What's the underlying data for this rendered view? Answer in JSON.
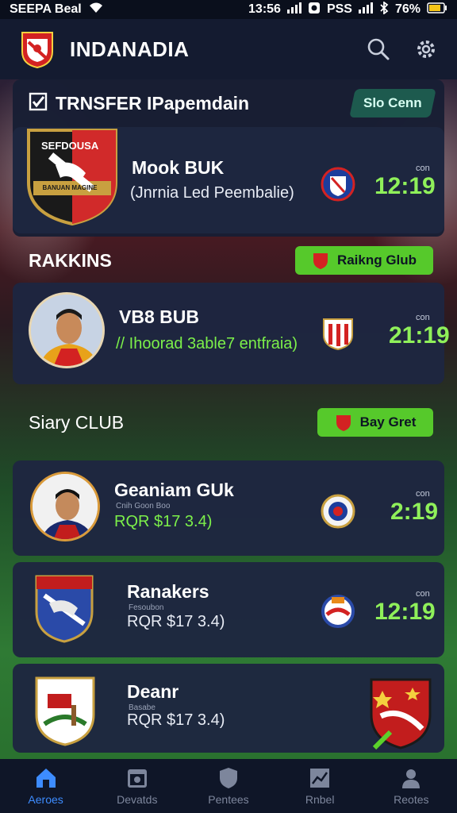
{
  "status_bar": {
    "carrier": "SEEPA Beal",
    "time": "13:56",
    "signal_text": "PSS",
    "battery": "76%"
  },
  "header": {
    "title": "INDANADIA"
  },
  "transfer_section": {
    "title": "TRNSFER IPapemdain",
    "pill_label": "Slo Cenn",
    "row": {
      "crest_text": "SEFDOUSA",
      "crest_banner": "BANUAN MAGINE",
      "name": "Mook BUK",
      "subtitle": "(Jnrnia Led Peembalie)",
      "score_label": "con",
      "score": "12:19"
    }
  },
  "rankings_section": {
    "title": "RAKKINS",
    "pill_label": "Raikng Glub",
    "row": {
      "name": "VB8 BUB",
      "subtitle": "// Ihoorad 3able7 entfraia)",
      "score_label": "con",
      "score": "21:19"
    }
  },
  "club_section": {
    "title": "Siary CLUB",
    "pill_label": "Bay Gret",
    "rows": [
      {
        "name": "Geaniam GUk",
        "tiny": "Cnih Goon Boo",
        "subtitle": "RQR $17 3.4)",
        "score_label": "con",
        "score": "2:19"
      },
      {
        "name": "Ranakers",
        "tiny": "Fesoubon",
        "subtitle": "RQR $17 3.4)",
        "score_label": "con",
        "score": "12:19"
      },
      {
        "name": "Deanr",
        "tiny": "Basabe",
        "subtitle": "RQR $17 3.4)"
      }
    ]
  },
  "bottom_nav": {
    "items": [
      {
        "label": "Aeroes",
        "icon": "home-icon"
      },
      {
        "label": "Devatds",
        "icon": "calendar-icon"
      },
      {
        "label": "Pentees",
        "icon": "shield-icon"
      },
      {
        "label": "Rnbel",
        "icon": "chart-icon"
      },
      {
        "label": "Reotes",
        "icon": "profile-icon"
      }
    ]
  },
  "colors": {
    "accent_green": "#56c92b",
    "score_green": "#8ff05a",
    "nav_active": "#3d8cff",
    "panel": "#181e34"
  }
}
